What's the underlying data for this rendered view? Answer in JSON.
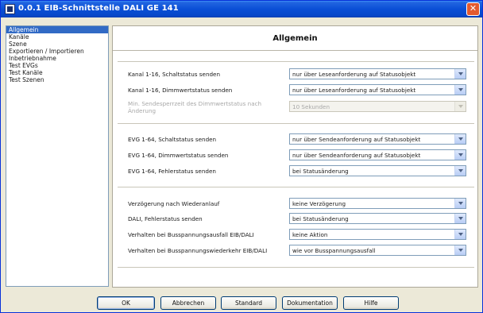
{
  "window": {
    "title": "0.0.1  EIB-Schnittstelle DALI GE 141",
    "close_glyph": "✕"
  },
  "sidebar": {
    "items": [
      {
        "label": "Allgemein",
        "selected": true
      },
      {
        "label": "Kanäle",
        "selected": false
      },
      {
        "label": "Szene",
        "selected": false
      },
      {
        "label": "Exportieren / Importieren",
        "selected": false
      },
      {
        "label": "Inbetriebnahme",
        "selected": false
      },
      {
        "label": "Test EVGs",
        "selected": false
      },
      {
        "label": "Test Kanäle",
        "selected": false
      },
      {
        "label": "Test Szenen",
        "selected": false
      }
    ]
  },
  "main": {
    "title": "Allgemein",
    "rows": [
      {
        "label": "Kanal 1-16, Schaltstatus senden",
        "value": "nur über Leseanforderung auf Statusobjekt",
        "disabled": false
      },
      {
        "label": "Kanal 1-16, Dimmwertstatus senden",
        "value": "nur über Leseanforderung auf Statusobjekt",
        "disabled": false
      },
      {
        "label": "Min. Sendesperrzeit des Dimmwertstatus nach Änderung",
        "value": "10 Sekunden",
        "disabled": true
      },
      {
        "label": "EVG 1-64, Schaltstatus senden",
        "value": "nur über Sendeanforderung auf Statusobjekt",
        "disabled": false
      },
      {
        "label": "EVG 1-64, Dimmwertstatus senden",
        "value": "nur über Sendeanforderung auf Statusobjekt",
        "disabled": false
      },
      {
        "label": "EVG 1-64, Fehlerstatus senden",
        "value": "bei Statusänderung",
        "disabled": false
      },
      {
        "label": "Verzögerung nach Wiederanlauf",
        "value": "keine Verzögerung",
        "disabled": false
      },
      {
        "label": "DALI, Fehlerstatus senden",
        "value": "bei Statusänderung",
        "disabled": false
      },
      {
        "label": "Verhalten bei Busspannungsausfall EIB/DALI",
        "value": "keine Aktion",
        "disabled": false
      },
      {
        "label": "Verhalten bei Busspannungswiederkehr EIB/DALI",
        "value": "wie vor Busspannungsausfall",
        "disabled": false
      }
    ]
  },
  "buttons": {
    "ok": "OK",
    "cancel": "Abbrechen",
    "standard": "Standard",
    "documentation": "Dokumentation",
    "help": "Hilfe"
  },
  "colors": {
    "titlebar": "#0a4fd6",
    "selection": "#316ac5",
    "dialog_bg": "#ece9d8"
  }
}
